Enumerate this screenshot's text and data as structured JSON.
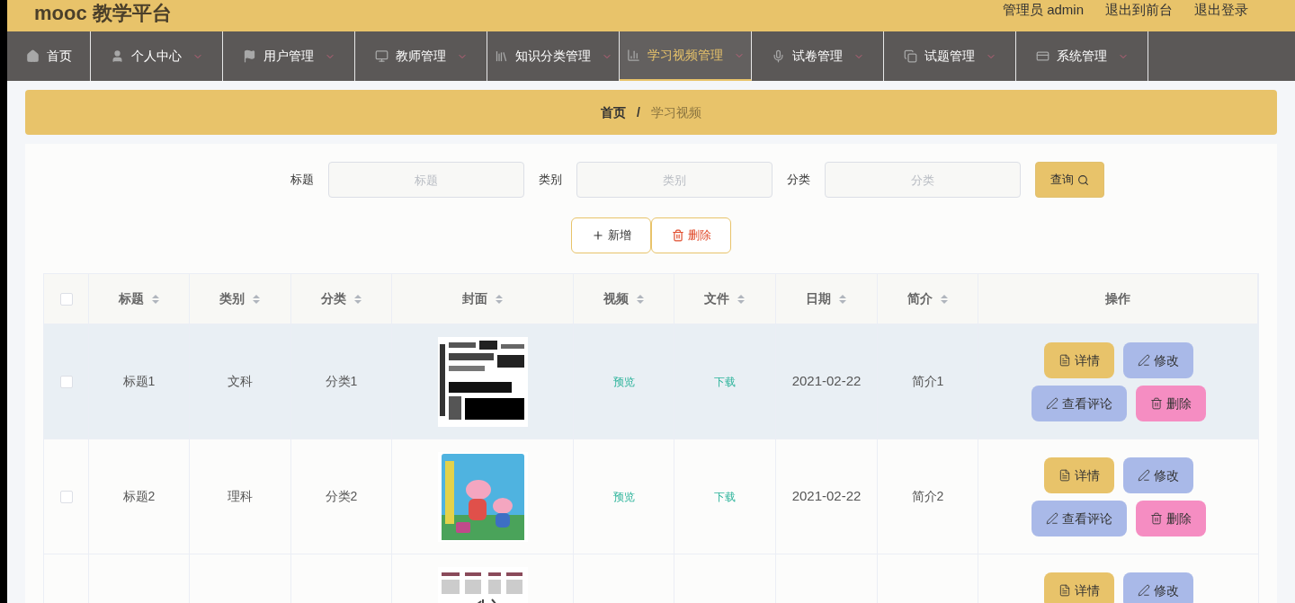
{
  "header": {
    "title": "mooc 教学平台",
    "links": [
      "管理员 admin",
      "退出到前台",
      "退出登录"
    ]
  },
  "nav": [
    {
      "label": "首页",
      "dropdown": false,
      "selected": false
    },
    {
      "label": "个人中心",
      "dropdown": true,
      "selected": false
    },
    {
      "label": "用户管理",
      "dropdown": true,
      "selected": false
    },
    {
      "label": "教师管理",
      "dropdown": true,
      "selected": false
    },
    {
      "label": "知识分类管理",
      "dropdown": true,
      "selected": false
    },
    {
      "label": "学习视频管理",
      "dropdown": true,
      "selected": true
    },
    {
      "label": "试卷管理",
      "dropdown": true,
      "selected": false
    },
    {
      "label": "试题管理",
      "dropdown": true,
      "selected": false
    },
    {
      "label": "系统管理",
      "dropdown": true,
      "selected": false
    }
  ],
  "breadcrumb": [
    "首页",
    "/",
    "学习视频"
  ],
  "search": {
    "fields": [
      {
        "label": "标题",
        "placeholder": "标题"
      },
      {
        "label": "类别",
        "placeholder": "类别"
      },
      {
        "label": "分类",
        "placeholder": "分类"
      }
    ],
    "button": "查询"
  },
  "toolbar": [
    {
      "kind": "add",
      "label": "新增"
    },
    {
      "kind": "delete",
      "label": "删除"
    }
  ],
  "table": {
    "columns": [
      "标题",
      "类别",
      "分类",
      "封面",
      "视频",
      "文件",
      "日期",
      "简介",
      "操作"
    ],
    "header_checked": false,
    "rows": [
      {
        "checked": false,
        "hovered": true,
        "title": "标题1",
        "type": "文科",
        "category": "分类1",
        "cover": {
          "kind": "picture"
        },
        "video": "预览",
        "file": "下载",
        "date": "2021-02-22",
        "intro": "简介1",
        "actions": [
          {
            "kind": "detail",
            "label": "详情"
          },
          {
            "kind": "edit",
            "label": "修改"
          },
          {
            "kind": "comments",
            "label": "查看评论"
          },
          {
            "kind": "delete",
            "label": "删除"
          }
        ]
      },
      {
        "checked": false,
        "hovered": false,
        "title": "标题2",
        "type": "理科",
        "category": "分类2",
        "cover": {
          "kind": "picture"
        },
        "video": "预览",
        "file": "下载",
        "date": "2021-02-22",
        "intro": "简介2",
        "actions": [
          {
            "kind": "detail",
            "label": "详情"
          },
          {
            "kind": "edit",
            "label": "修改"
          },
          {
            "kind": "comments",
            "label": "查看评论"
          },
          {
            "kind": "delete",
            "label": "删除"
          }
        ]
      },
      {
        "hovered": false,
        "cover": {
          "kind": "picture"
        },
        "actions": [
          {
            "kind": "detail",
            "label": "详情"
          },
          {
            "kind": "edit",
            "label": "修改"
          }
        ]
      }
    ]
  }
}
